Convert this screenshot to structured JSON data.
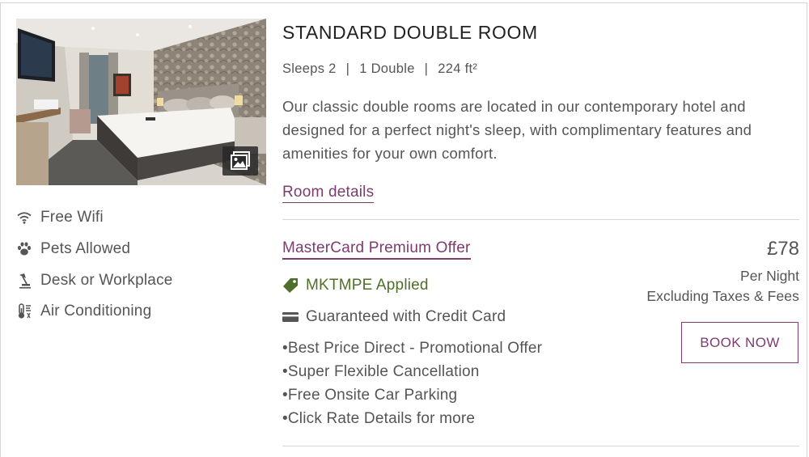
{
  "room": {
    "title": "STANDARD DOUBLE ROOM",
    "sleeps": "Sleeps 2",
    "beds": "1 Double",
    "size": "224 ft²",
    "separator": "|",
    "description": "Our classic double rooms are located in our contemporary hotel and designed for a perfect night's sleep, with complimentary features and amenities for your own comfort.",
    "details_link": "Room details"
  },
  "amenities": [
    {
      "icon": "wifi-icon",
      "label": "Free Wifi"
    },
    {
      "icon": "paw-icon",
      "label": "Pets Allowed"
    },
    {
      "icon": "desk-lamp-icon",
      "label": "Desk or Workplace"
    },
    {
      "icon": "thermometer-icon",
      "label": "Air Conditioning"
    }
  ],
  "offer": {
    "name": "MasterCard Premium Offer",
    "promo_applied": "MKTMPE Applied",
    "guarantee": "Guaranteed with Credit Card",
    "bullets": [
      "•Best Price Direct - Promotional Offer",
      "•Super Flexible Cancellation",
      "•Free Onsite Car Parking",
      "•Click Rate Details for more"
    ],
    "price": "£78",
    "per_night": "Per Night",
    "taxes_note": "Excluding Taxes & Fees",
    "book_label": "BOOK NOW"
  },
  "colors": {
    "accent": "#7d3b6e",
    "promo_green": "#4f6f2a",
    "text": "#555555",
    "title": "#222222",
    "divider": "#d6d6d6"
  },
  "icons": {
    "gallery": "gallery-icon",
    "tag": "tag-icon",
    "credit_card": "credit-card-icon"
  }
}
